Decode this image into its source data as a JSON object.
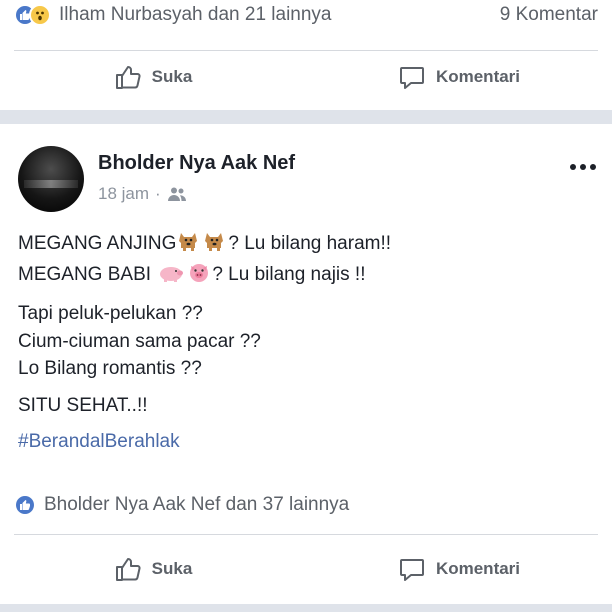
{
  "post1": {
    "reaction_summary": "Ilham Nurbasyah dan 21 lainnya",
    "comment_count": "9 Komentar",
    "actions": {
      "like": "Suka",
      "comment": "Komentari"
    }
  },
  "post2": {
    "author": "Bholder Nya Aak Nef",
    "time": "18 jam",
    "dot": "·",
    "lines": {
      "l1a": "MEGANG ANJING",
      "l1b": "? Lu bilang haram!!",
      "l2a": "MEGANG BABI",
      "l2b": "? Lu bilang najis !!",
      "l3": "Tapi peluk-pelukan ??",
      "l4": "Cium-ciuman sama pacar ??",
      "l5": "Lo Bilang romantis ??",
      "l6": "SITU SEHAT..!!",
      "hashtag": "#BerandalBerahlak"
    },
    "reaction_summary": "Bholder Nya Aak Nef dan 37 lainnya",
    "actions": {
      "like": "Suka",
      "comment": "Komentari"
    }
  },
  "icons": {
    "like_reaction": "like-reaction-icon",
    "wow_reaction": "wow-reaction-icon",
    "like": "thumbs-up-icon",
    "comment": "comment-bubble-icon",
    "audience": "friends-icon",
    "more": "more-options-icon",
    "dog_emoji": "dog-emoji",
    "pig_emoji": "pig-emoji"
  },
  "colors": {
    "facebook_blue": "#4a78c9",
    "hashtag": "#4a6aa8",
    "muted": "#5c6168",
    "feed_bg": "#dfe3ea"
  }
}
